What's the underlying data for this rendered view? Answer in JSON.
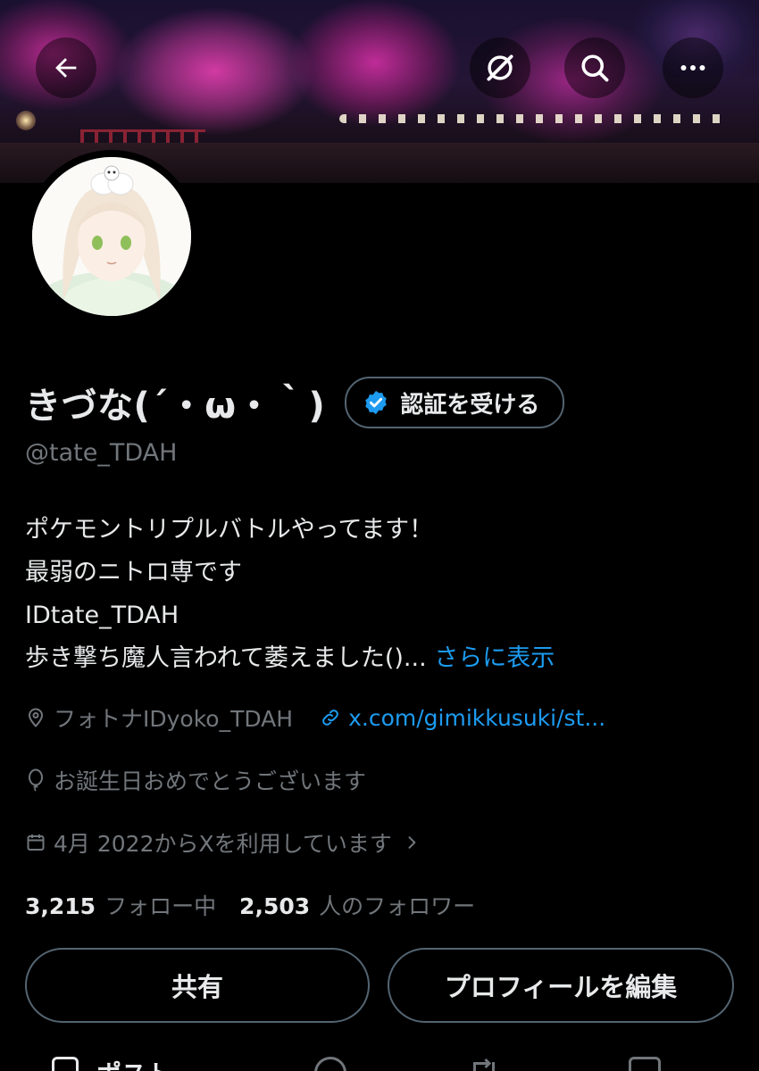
{
  "header": {
    "back_icon": "arrow-left-icon",
    "grok_icon": "grok-icon",
    "search_icon": "search-icon",
    "more_icon": "more-horizontal-icon"
  },
  "profile": {
    "display_name": "きづな(´・ω・｀)",
    "verify_label": "認証を受ける",
    "handle": "@tate_TDAH",
    "bio_lines": [
      "ポケモントリプルバトルやってます！",
      "最弱のニトロ専です",
      "IDtate_TDAH",
      "歩き撃ち魔人言われて萎えました()..."
    ],
    "bio_more": "さらに表示",
    "location": "フォトナIDyoko_TDAH",
    "link": "x.com/gimikkusuki/st...",
    "birthday": "お誕生日おめでとうございます",
    "joined": "4月 2022からXを利用しています"
  },
  "stats": {
    "following_count": "3,215",
    "following_label": "フォロー中",
    "followers_count": "2,503",
    "followers_label": "人のフォロワー"
  },
  "actions": {
    "share_label": "共有",
    "edit_label": "プロフィールを編集"
  },
  "tabs": {
    "posts_label": "ポスト"
  },
  "colors": {
    "background": "#000000",
    "text": "#e7e9ea",
    "muted": "#71767b",
    "accent": "#1d9bf0",
    "border": "#536471"
  }
}
